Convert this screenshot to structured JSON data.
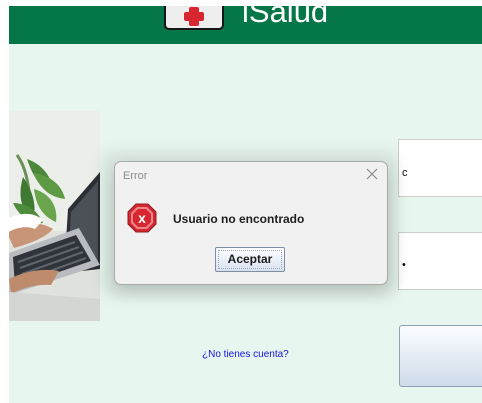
{
  "app": {
    "title": "iSalud"
  },
  "login_form": {
    "username_value": "c",
    "password_mask": "•",
    "signup_link": "¿No tienes cuenta?"
  },
  "error_dialog": {
    "title": "Error",
    "message": "Usuario no encontrado",
    "ok_label": "Aceptar",
    "icon": "error-x-icon"
  },
  "colors": {
    "header": "#047648",
    "background": "#e7f6ee",
    "link": "#1515e6",
    "error_icon": "#d7262f"
  }
}
